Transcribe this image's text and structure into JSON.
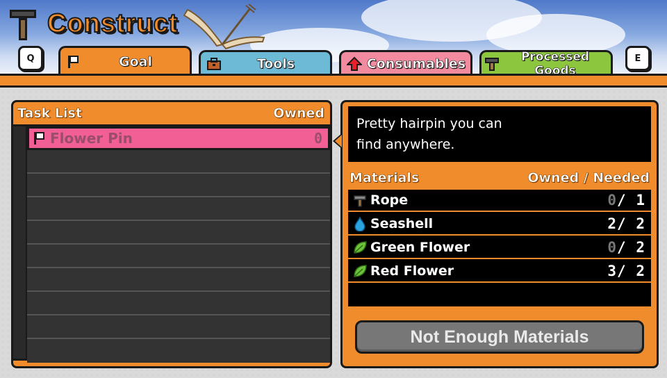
{
  "header": {
    "title": "Construct",
    "key_left": "Q",
    "key_right": "E"
  },
  "tabs": [
    {
      "label": "Goal",
      "color": "#f08c2c",
      "active": true,
      "icon": "flag-icon"
    },
    {
      "label": "Tools",
      "color": "#6dbad6",
      "active": false,
      "icon": "toolbox-icon"
    },
    {
      "label": "Consumables",
      "color": "#f28aa0",
      "active": false,
      "icon": "up-arrow-icon"
    },
    {
      "label": "Processed Goods",
      "color": "#8cc63e",
      "active": false,
      "icon": "hammer-icon"
    }
  ],
  "task_list": {
    "header": "Task List",
    "owned_header": "Owned",
    "items": [
      {
        "name": "Flower Pin",
        "owned": "0",
        "icon": "flag-icon",
        "selected": true
      }
    ]
  },
  "details": {
    "description_line1": "Pretty hairpin you can",
    "description_line2": "find anywhere.",
    "materials_header": "Materials",
    "owned_needed_header": "Owned / Needed",
    "materials": [
      {
        "name": "Rope",
        "owned": "0",
        "needed": "1",
        "icon": "hammer-icon"
      },
      {
        "name": "Seashell",
        "owned": "2",
        "needed": "2",
        "icon": "water-drop-icon"
      },
      {
        "name": "Green Flower",
        "owned": "0",
        "needed": "2",
        "icon": "leaf-icon"
      },
      {
        "name": "Red Flower",
        "owned": "3",
        "needed": "2",
        "icon": "leaf-icon"
      }
    ],
    "button_label": "Not Enough Materials"
  }
}
